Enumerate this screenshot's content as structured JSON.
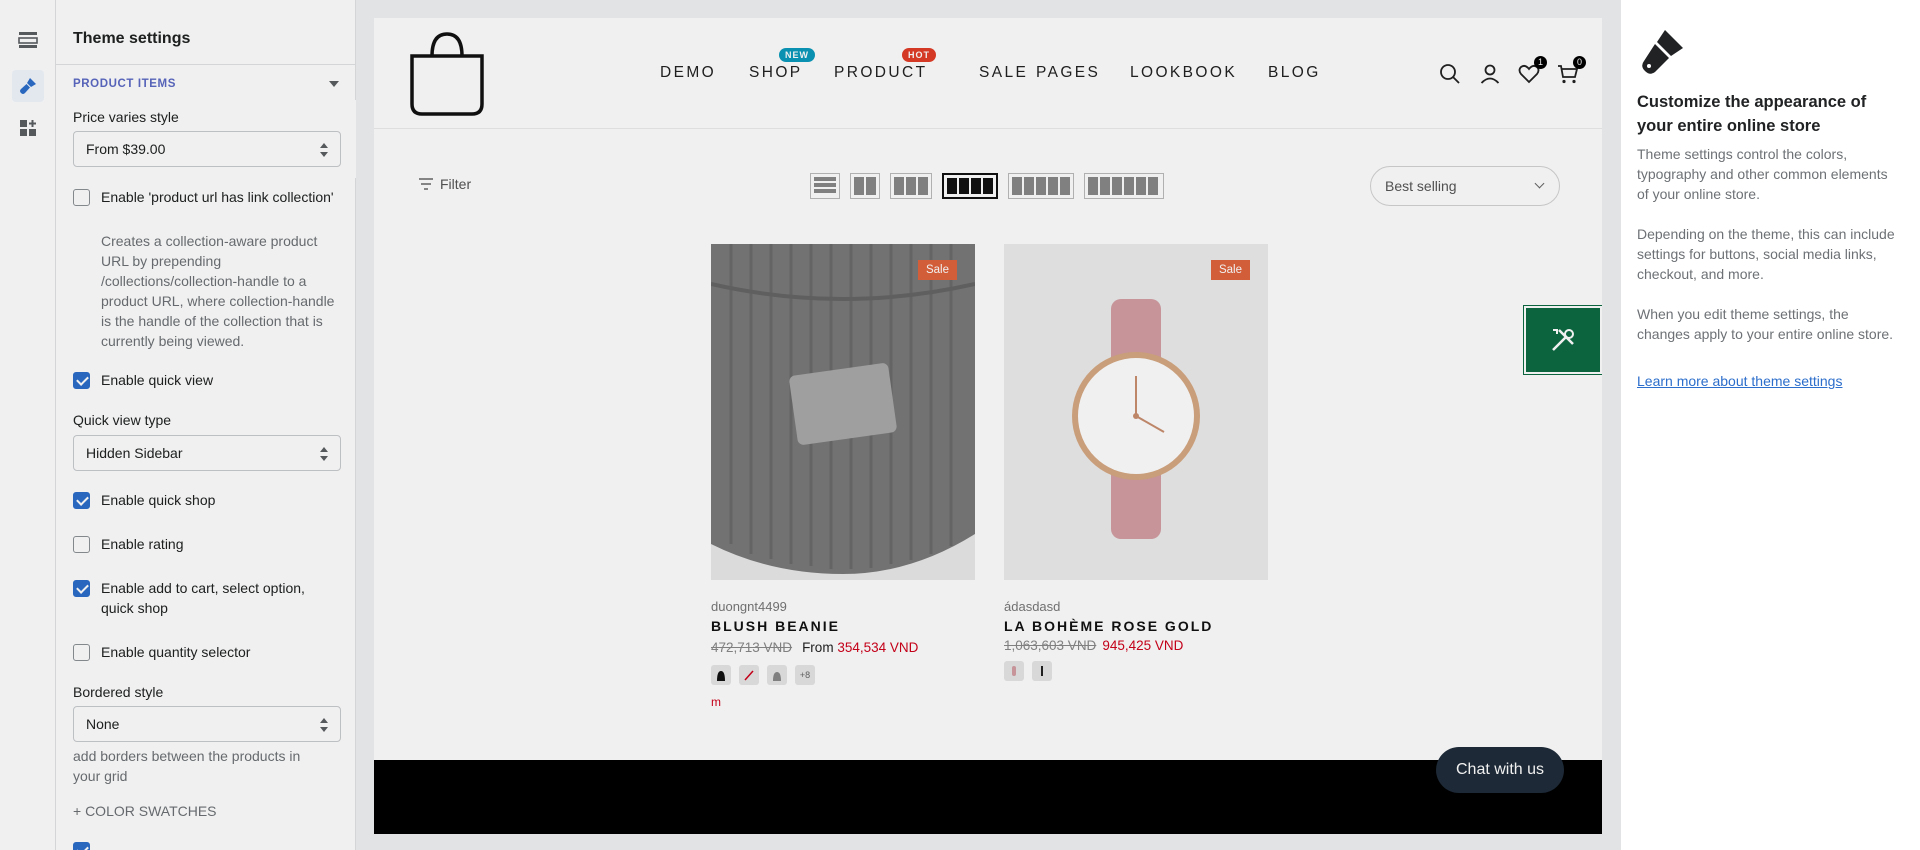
{
  "rail": {
    "items": [
      "sections-icon",
      "theme-settings-icon",
      "apps-icon"
    ]
  },
  "settings": {
    "title": "Theme settings",
    "section": "PRODUCT ITEMS",
    "price_varies_label": "Price varies style",
    "price_varies_value": "From $39.00",
    "url_collection_label": "Enable 'product url has link collection'",
    "url_collection_help": "Creates a collection-aware product URL by prepending /collections/collection-handle to a product URL, where collection-handle is the handle of the collection that is currently being viewed.",
    "quick_view_label": "Enable quick view",
    "quick_view_type_label": "Quick view type",
    "quick_view_type_value": "Hidden Sidebar",
    "quick_shop_label": "Enable quick shop",
    "rating_label": "Enable rating",
    "add_to_cart_label": "Enable add to cart, select option, quick shop",
    "qty_selector_label": "Enable quantity selector",
    "bordered_label": "Bordered style",
    "bordered_value": "None",
    "bordered_help": "add borders between the products in your grid",
    "color_swatches_link": "+ COLOR SWATCHES",
    "checkboxes": {
      "url_collection": false,
      "quick_view": true,
      "quick_shop": true,
      "rating": false,
      "add_to_cart": true,
      "qty_selector": false
    }
  },
  "store": {
    "nav": [
      "DEMO",
      "SHOP",
      "PRODUCT",
      "SALE",
      "PAGES",
      "LOOKBOOK",
      "BLOG"
    ],
    "badges": {
      "shop": "NEW",
      "product": "HOT"
    },
    "badge_colors": {
      "new": "#0b9bbd",
      "hot": "#e23d28"
    },
    "wishlist_count": "1",
    "cart_count": "0",
    "filter_label": "Filter",
    "sort_label": "Best selling",
    "products": [
      {
        "sale": "Sale",
        "vendor": "duongnt4499",
        "name": "BLUSH BEANIE",
        "old_price": "472,713 VND",
        "from": "From",
        "new_price": "354,534 VND",
        "more_swatches": "+8",
        "mark": "m"
      },
      {
        "sale": "Sale",
        "vendor": "ádasdasd",
        "name": "LA BOHÈME ROSE GOLD",
        "old_price": "1,063,603 VND",
        "new_price": "945,425 VND"
      }
    ],
    "chat_label": "Chat with us"
  },
  "info": {
    "title": "Customize the appearance of your entire online store",
    "p1": "Theme settings control the colors, typography and other common elements of your online store.",
    "p2": "Depending on the theme, this can include settings for buttons, social media links, checkout, and more.",
    "p3": "When you edit theme settings, the changes apply to your entire online store.",
    "link": "Learn more about theme settings"
  }
}
